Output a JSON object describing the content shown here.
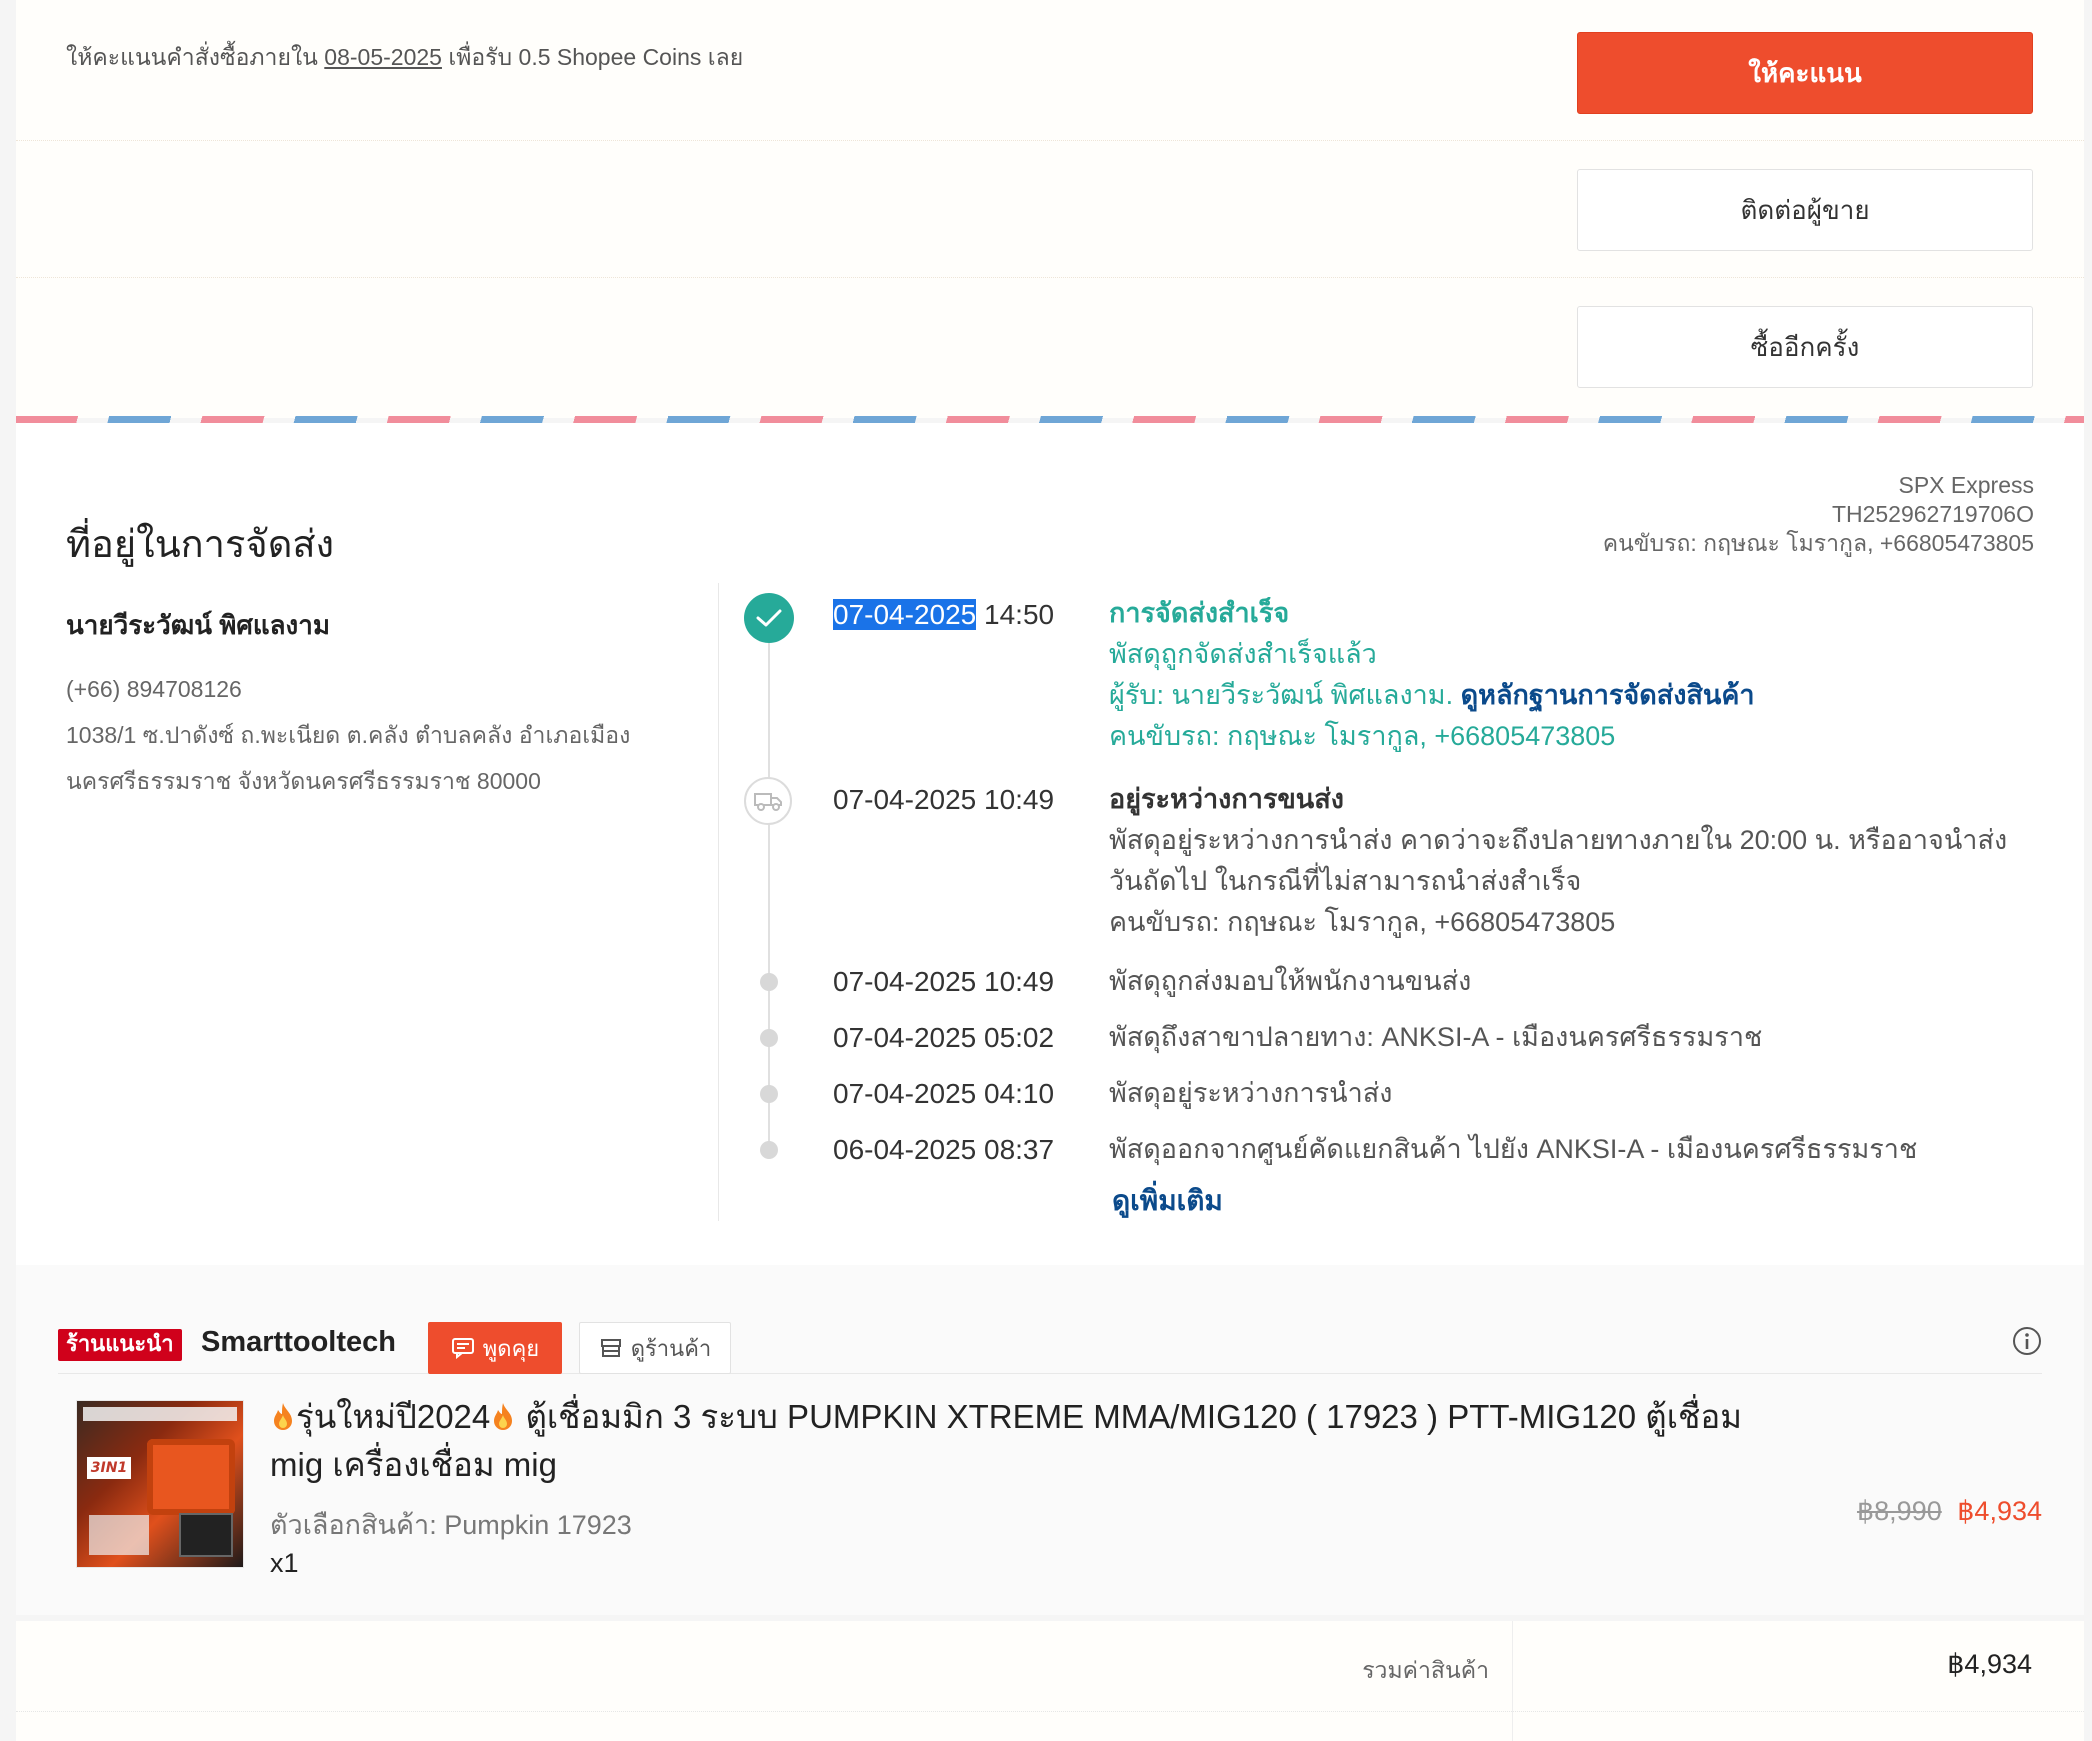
{
  "rating": {
    "text_prefix": "ให้คะแนนคำสั่งซื้อภายใน",
    "deadline": "08-05-2025",
    "text_suffix": "เพื่อรับ 0.5 Shopee Coins เลย",
    "rate_button": "ให้คะแนน",
    "contact_button": "ติดต่อผู้ขาย",
    "buy_again_button": "ซื้ออีกครั้ง"
  },
  "shipping": {
    "title": "ที่อยู่ในการจัดส่ง",
    "carrier_name": "SPX Express",
    "tracking_number": "TH252962719706O",
    "carrier_driver": "คนขับรถ: กฤษณะ โมรากูล, +66805473805",
    "recipient": {
      "name": "นายวีระวัฒน์ พิศแลงาม",
      "phone": "(+66) 894708126",
      "address_line1": "1038/1 ซ.ปาดังซ์ ถ.พะเนียด ต.คลัง ตำบลคลัง อำเภอเมือง",
      "address_line2": "นครศรีธรรมราช จังหวัดนครศรีธรรมราช 80000"
    },
    "timeline": [
      {
        "date": "07-04-2025",
        "time": "14:50",
        "status": "การจัดส่งสำเร็จ",
        "line1": "พัสดุถูกจัดส่งสำเร็จแล้ว",
        "line2_prefix": "ผู้รับ: นายวีระวัฒน์ พิศแลงาม.",
        "line2_link": "ดูหลักฐานการจัดส่งสินค้า",
        "line3": "คนขับรถ: กฤษณะ โมรากูล, +66805473805"
      },
      {
        "datetime": "07-04-2025 10:49",
        "status": "อยู่ระหว่างการขนส่ง",
        "line1": "พัสดุอยู่ระหว่างการนำส่ง คาดว่าจะถึงปลายทางภายใน 20:00 น. หรืออาจนำส่ง",
        "line2": "วันถัดไป ในกรณีที่ไม่สามารถนำส่งสำเร็จ",
        "line3": "คนขับรถ: กฤษณะ โมรากูล, +66805473805"
      },
      {
        "datetime": "07-04-2025 10:49",
        "text": "พัสดุถูกส่งมอบให้พนักงานขนส่ง"
      },
      {
        "datetime": "07-04-2025 05:02",
        "text": "พัสดุถึงสาขาปลายทาง: ANKSI-A - เมืองนครศรีธรรมราช"
      },
      {
        "datetime": "07-04-2025 04:10",
        "text": "พัสดุอยู่ระหว่างการนำส่ง"
      },
      {
        "datetime": "06-04-2025 08:37",
        "text": "พัสดุออกจากศูนย์คัดแยกสินค้า ไปยัง ANKSI-A - เมืองนครศรีธรรมราช"
      }
    ],
    "see_more": "ดูเพิ่มเติม"
  },
  "shop": {
    "badge": "ร้านแนะนำ",
    "name": "Smarttooltech",
    "chat_button": "พูดคุย",
    "view_shop_button": "ดูร้านค้า"
  },
  "product": {
    "title_part1": "รุ่นใหม่ปี2024",
    "title_part2": "ตู้เชื่อมมิก 3 ระบบ PUMPKIN XTREME MMA/MIG120 ( 17923 ) PTT-MIG120 ตู้เชื่อม mig เครื่องเชื่อม mig",
    "variant": "ตัวเลือกสินค้า: Pumpkin 17923",
    "quantity": "x1",
    "original_price": "฿8,990",
    "price": "฿4,934"
  },
  "totals": {
    "subtotal_label": "รวมค่าสินค้า",
    "subtotal_value": "฿4,934"
  },
  "colors": {
    "brand": "#ee4d2d",
    "success": "#26aa99",
    "link": "#0b4a8b"
  }
}
